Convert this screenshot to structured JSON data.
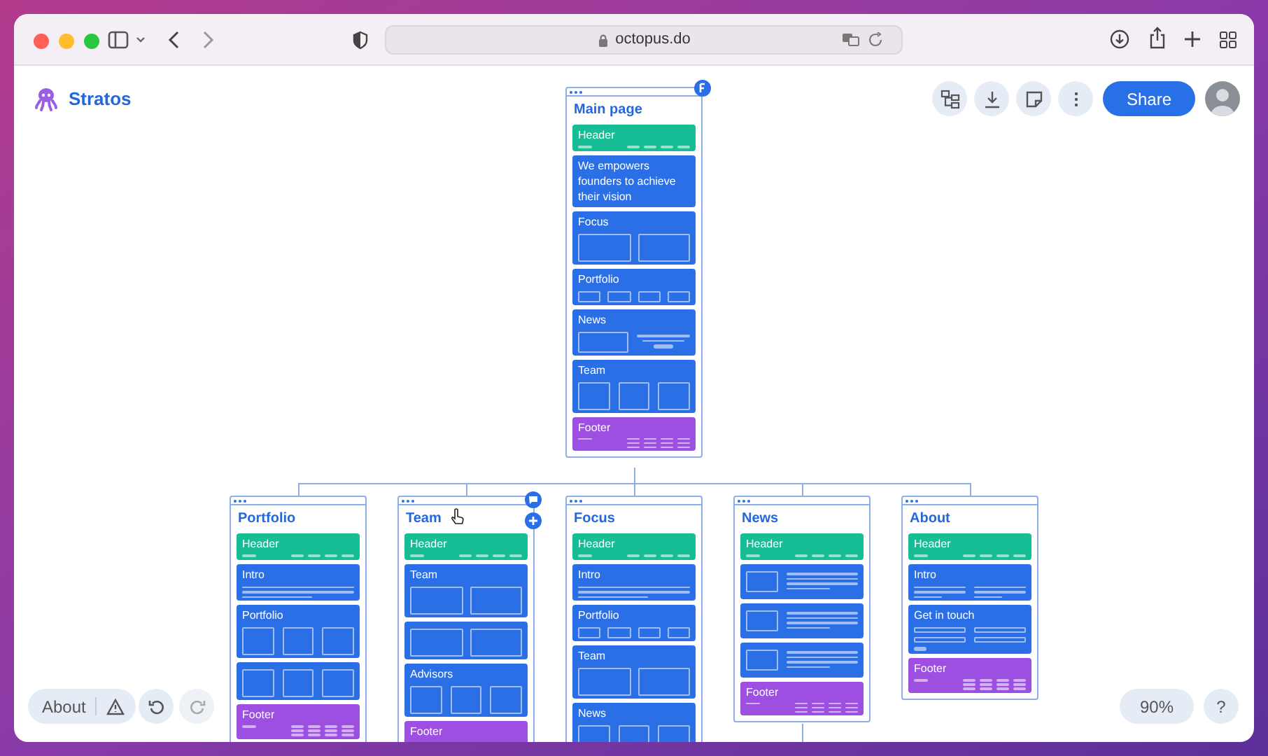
{
  "browser": {
    "url": "octopus.do"
  },
  "app": {
    "name": "Stratos",
    "share_label": "Share"
  },
  "main_page": {
    "title": "Main page",
    "sections": [
      {
        "kind": "nav",
        "label": "Header"
      },
      {
        "kind": "block",
        "label": "We empowers founders to achieve their vision"
      },
      {
        "kind": "boxes2",
        "label": "Focus"
      },
      {
        "kind": "chips4",
        "label": "Portfolio"
      },
      {
        "kind": "media-summary",
        "label": "News"
      },
      {
        "kind": "boxes3",
        "label": "Team"
      },
      {
        "kind": "footer",
        "label": "Footer"
      }
    ]
  },
  "pages": [
    {
      "title": "Portfolio",
      "sections": [
        {
          "kind": "nav",
          "label": "Header"
        },
        {
          "kind": "text",
          "label": "Intro"
        },
        {
          "kind": "boxes3",
          "label": "Portfolio"
        },
        {
          "kind": "boxes3"
        },
        {
          "kind": "footer",
          "label": "Footer"
        }
      ]
    },
    {
      "title": "Team",
      "sections": [
        {
          "kind": "nav",
          "label": "Header"
        },
        {
          "kind": "boxes2",
          "label": "Team"
        },
        {
          "kind": "boxes2"
        },
        {
          "kind": "boxes3",
          "label": "Advisors"
        },
        {
          "kind": "footer",
          "label": "Footer"
        }
      ]
    },
    {
      "title": "Focus",
      "sections": [
        {
          "kind": "nav",
          "label": "Header"
        },
        {
          "kind": "text",
          "label": "Intro"
        },
        {
          "kind": "chips4",
          "label": "Portfolio"
        },
        {
          "kind": "boxes2",
          "label": "Team"
        },
        {
          "kind": "boxes3",
          "label": "News"
        }
      ]
    },
    {
      "title": "News",
      "sections": [
        {
          "kind": "nav",
          "label": "Header"
        },
        {
          "kind": "media-list"
        },
        {
          "kind": "media-list"
        },
        {
          "kind": "media-list"
        },
        {
          "kind": "footer",
          "label": "Footer"
        }
      ]
    },
    {
      "title": "About",
      "sections": [
        {
          "kind": "nav",
          "label": "Header"
        },
        {
          "kind": "cols2text",
          "label": "Intro"
        },
        {
          "kind": "form",
          "label": "Get in touch"
        },
        {
          "kind": "footer",
          "label": "Footer"
        }
      ]
    }
  ],
  "bottom_bar": {
    "about": "About",
    "zoom": "90%",
    "help": "?"
  }
}
